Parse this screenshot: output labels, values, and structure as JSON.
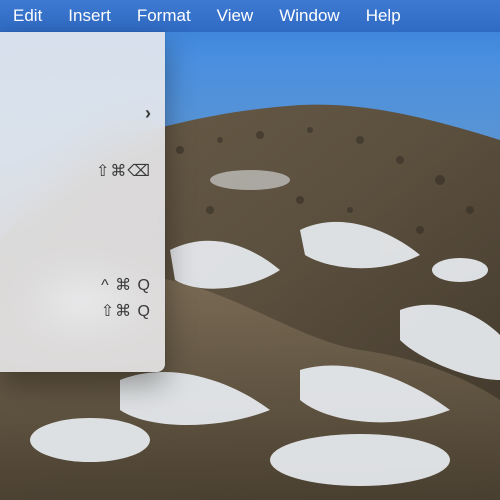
{
  "menubar": {
    "items": [
      {
        "label": "Edit"
      },
      {
        "label": "Insert"
      },
      {
        "label": "Format"
      },
      {
        "label": "View"
      },
      {
        "label": "Window"
      },
      {
        "label": "Help"
      }
    ]
  },
  "dropdown": {
    "submenu_indicator": "›",
    "shortcuts": {
      "row1": "⇧⌘⌫",
      "row2_a": "^ ⌘ Q",
      "row2_b": "⇧⌘ Q"
    }
  }
}
